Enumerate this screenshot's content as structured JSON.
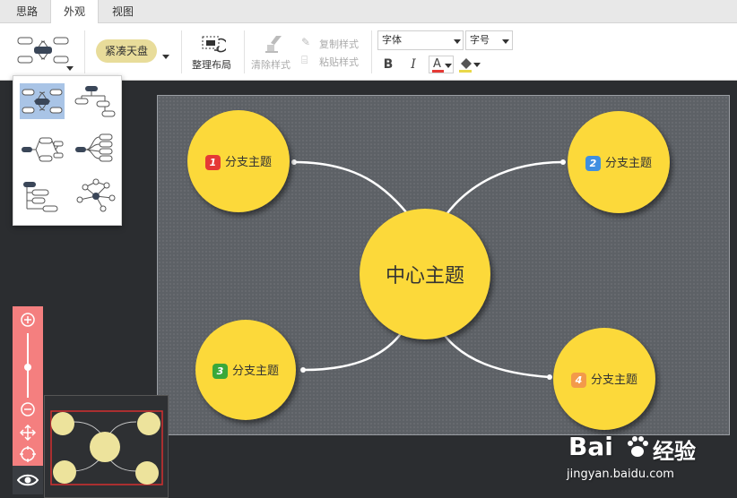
{
  "tabs": [
    {
      "label": "思路"
    },
    {
      "label": "外观"
    },
    {
      "label": "视图"
    }
  ],
  "toolbar": {
    "theme_label": "紧凑天盘",
    "arrange_label": "整理布局",
    "clear_style_label": "清除样式",
    "copy_style_label": "复制样式",
    "paste_style_label": "粘贴样式",
    "font_label": "字体",
    "size_label": "字号",
    "bold_label": "B",
    "italic_label": "I",
    "font_color_label": "A"
  },
  "mindmap": {
    "center": "中心主题",
    "branches": [
      {
        "badge": "1",
        "label": "分支主题",
        "badge_color": "#e53935"
      },
      {
        "badge": "2",
        "label": "分支主题",
        "badge_color": "#3f8fe0"
      },
      {
        "badge": "3",
        "label": "分支主题",
        "badge_color": "#3aa83a"
      },
      {
        "badge": "4",
        "label": "分支主题",
        "badge_color": "#f39a4a"
      }
    ]
  },
  "watermark": {
    "brand_left": "Bai",
    "brand_right": "经验",
    "url": "jingyan.baidu.com"
  },
  "colors": {
    "node_fill": "#fcd93a",
    "canvas_bg": "#5d6166",
    "zoom_bar": "#f47f7f",
    "theme_pill": "#e8dc9a",
    "layout_selected": "#a9c4e6"
  }
}
